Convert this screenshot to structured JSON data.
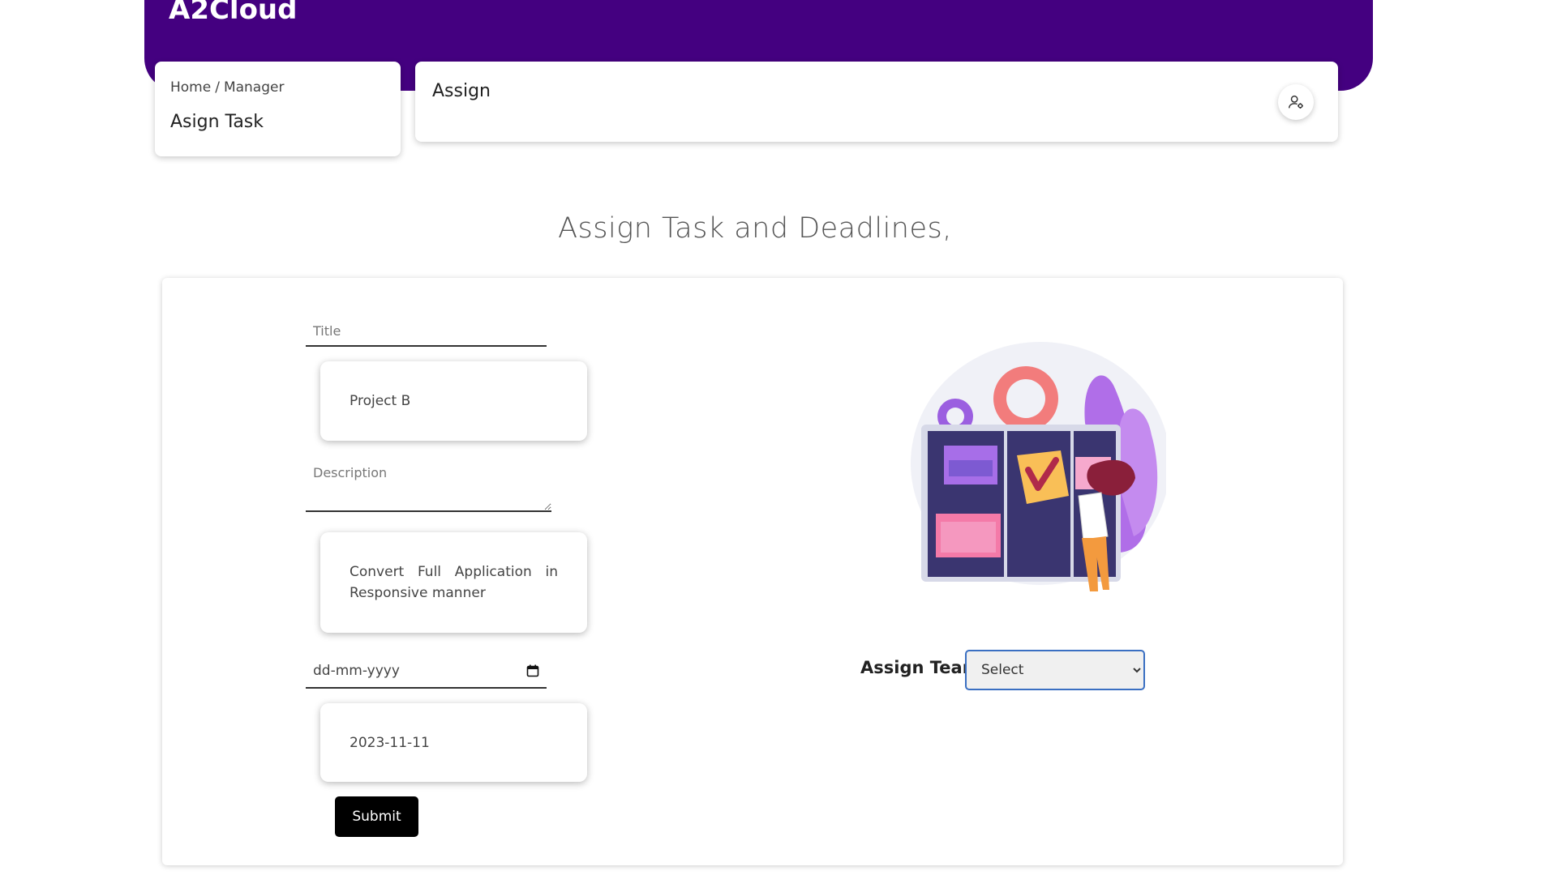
{
  "header": {
    "brand": "A2Cloud"
  },
  "breadcrumb": {
    "home": "Home",
    "separator": "/",
    "section": "Manager",
    "page_title": "Asign Task"
  },
  "assign_card": {
    "title": "Assign",
    "icon": "user-gear-icon"
  },
  "main": {
    "heading": "Assign Task and Deadlines,",
    "form": {
      "title_placeholder": "Title",
      "title_value_display": "Project B",
      "description_placeholder": "Description",
      "description_value_display": "Convert Full Application in Responsive manner",
      "date_placeholder": "dd-mm-yyyy",
      "date_value_display": "2023-11-11",
      "submit_label": "Submit"
    },
    "team": {
      "label": "Assign Team",
      "selected": "Select",
      "options": [
        "Select"
      ]
    }
  },
  "colors": {
    "brand_purple": "#440080",
    "select_border": "#3a6fc2",
    "submit_bg": "#000000"
  }
}
